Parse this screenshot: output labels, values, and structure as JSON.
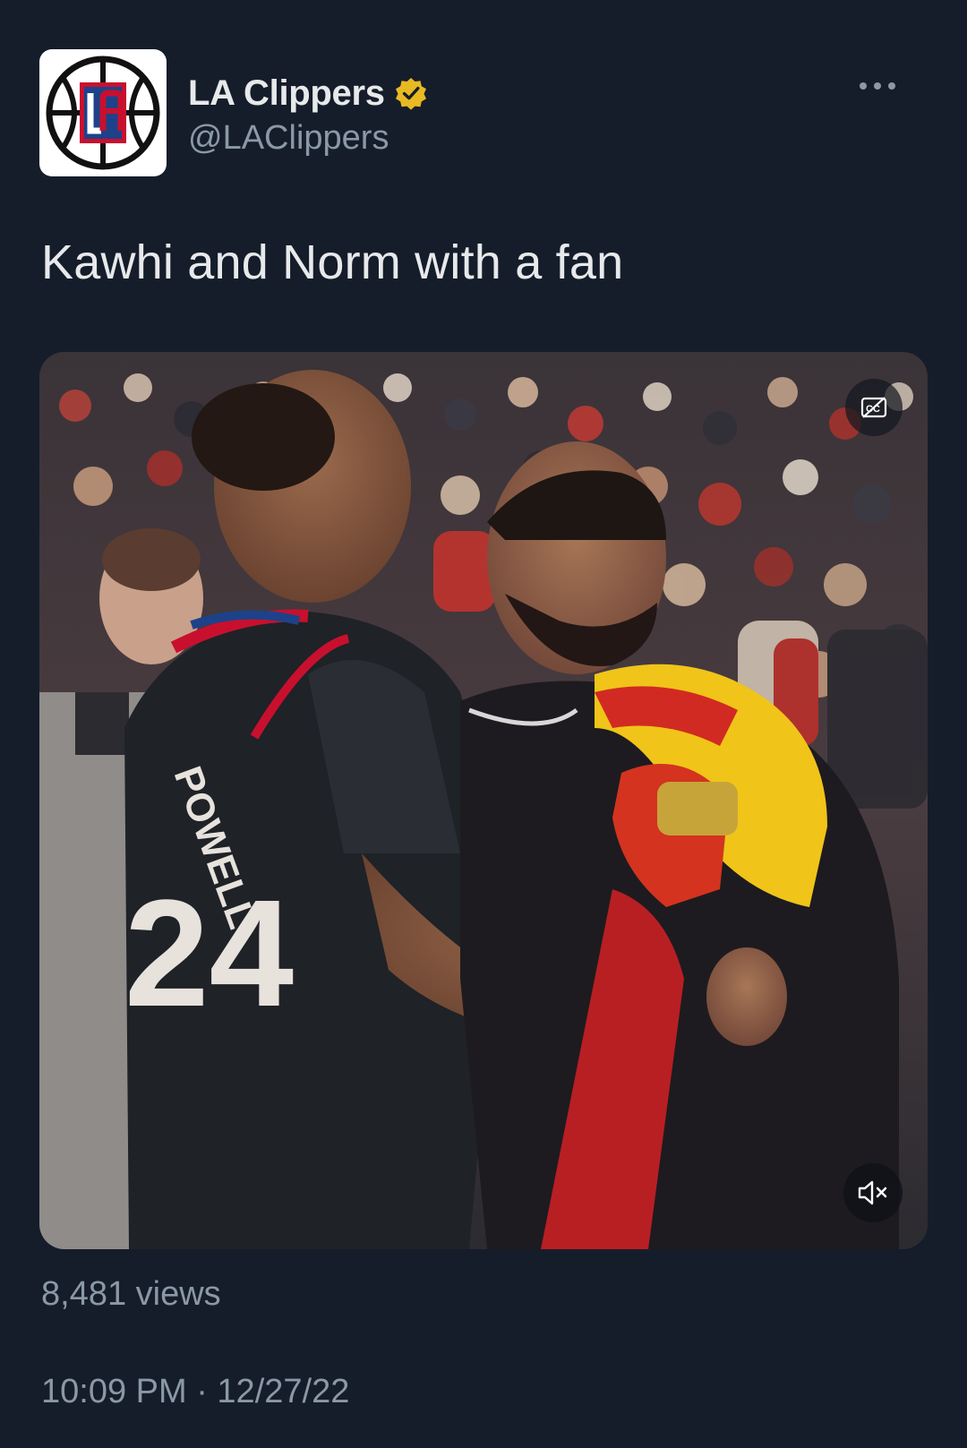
{
  "account": {
    "display_name": "LA Clippers",
    "handle": "@LAClippers",
    "avatar_icon": "la-clippers-logo-icon",
    "verified_icon": "verified-badge-icon",
    "verified_color": "#e8b923"
  },
  "tweet": {
    "text": "Kawhi and Norm with a fan",
    "more_icon": "more-options-icon"
  },
  "media": {
    "type": "video",
    "captions_icon": "closed-captions-icon",
    "mute_icon": "speaker-muted-icon"
  },
  "stats": {
    "views": "8,481 views"
  },
  "meta": {
    "timestamp": "10:09 PM · 12/27/22"
  },
  "colors": {
    "background": "#151d2b",
    "text_primary": "#e7e9ea",
    "text_secondary": "#8b98a5",
    "clippers_red": "#c8102e",
    "clippers_blue": "#1d428a"
  }
}
